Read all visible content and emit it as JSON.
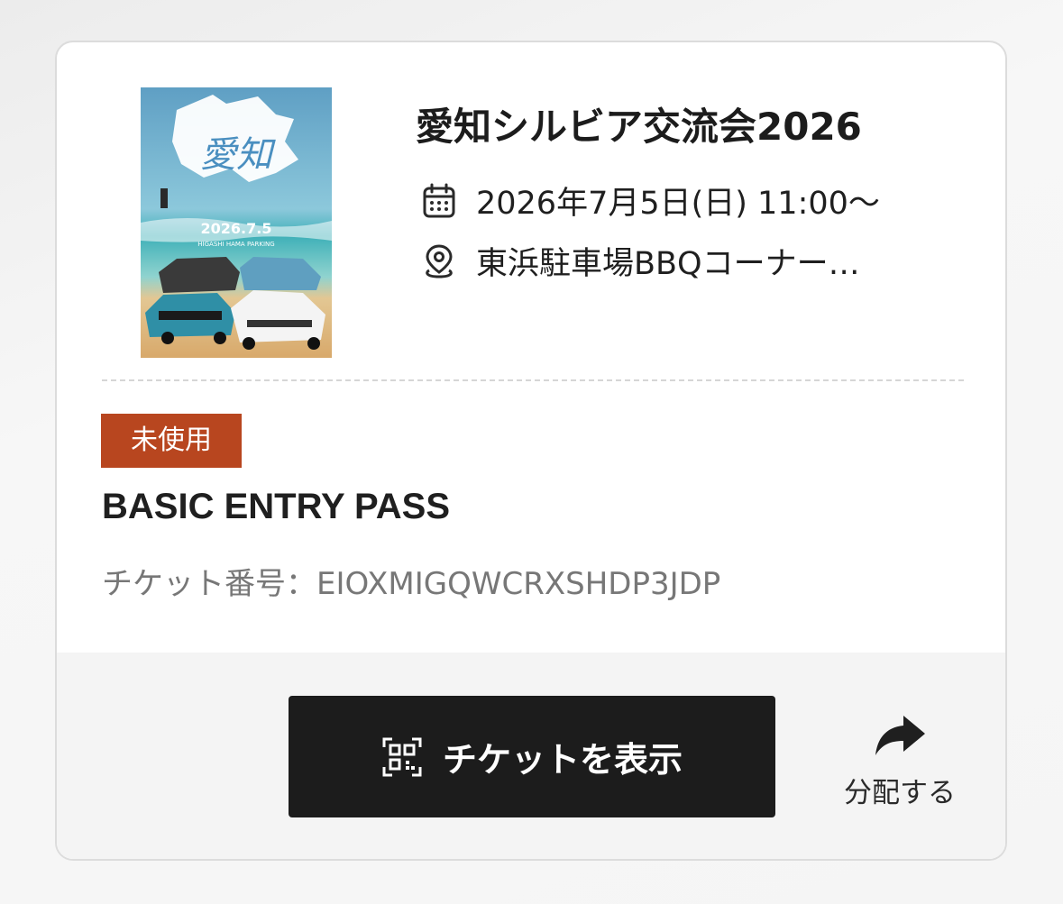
{
  "event": {
    "title": "愛知シルビア交流会2026",
    "date": "2026年7月5日(日) 11:00〜",
    "venue": "東浜駐車場BBQコーナー…",
    "poster": {
      "title": "愛知",
      "date_text": "2026.7.5",
      "sub_text": "HIGASHI HAMA PARKING",
      "colors": {
        "sky": "#6fb4cf",
        "sea": "#2aa0b0",
        "sand": "#e9c58a"
      }
    }
  },
  "ticket": {
    "status": "未使用",
    "status_color": "#b8461f",
    "pass_name": "BASIC ENTRY PASS",
    "number_label": "チケット番号：EIOXMIGQWCRXSHDP3JDP"
  },
  "actions": {
    "show_ticket_label": "チケットを表示",
    "show_ticket_icon": "qr-code-icon",
    "share_label": "分配する",
    "share_icon": "share-arrow-icon"
  }
}
